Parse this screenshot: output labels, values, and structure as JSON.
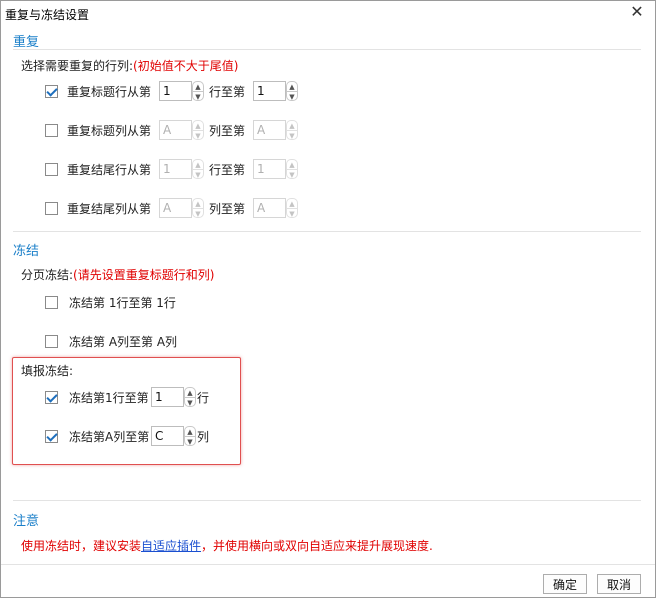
{
  "window": {
    "title": "重复与冻结设置"
  },
  "repeat": {
    "section_title": "重复",
    "prompt": "选择需要重复的行列:",
    "hint": "(初始值不大于尾值)",
    "rows": [
      {
        "label": "重复标题行从第",
        "checked": true,
        "from": "1",
        "mid": "行至第",
        "to": "1",
        "enabled": true
      },
      {
        "label": "重复标题列从第",
        "checked": false,
        "from": "A",
        "mid": "列至第",
        "to": "A",
        "enabled": false
      },
      {
        "label": "重复结尾行从第",
        "checked": false,
        "from": "1",
        "mid": "行至第",
        "to": "1",
        "enabled": false
      },
      {
        "label": "重复结尾列从第",
        "checked": false,
        "from": "A",
        "mid": "列至第",
        "to": "A",
        "enabled": false
      }
    ]
  },
  "freeze": {
    "section_title": "冻结",
    "page_prompt": "分页冻结:",
    "page_hint": "(请先设置重复标题行和列)",
    "page_rows": [
      {
        "label": "冻结第 1行至第 1行",
        "checked": false
      },
      {
        "label": "冻结第 A列至第 A列",
        "checked": false
      }
    ],
    "fill_prompt": "填报冻结:",
    "fill_rows": [
      {
        "label": "冻结第1行至第",
        "value": "1",
        "suffix": "行",
        "checked": true
      },
      {
        "label": "冻结第A列至第",
        "value": "C",
        "suffix": "列",
        "checked": true
      }
    ]
  },
  "notice": {
    "section_title": "注意",
    "text_before": "使用冻结时，建议安装",
    "link": "自适应插件",
    "text_after": "，并使用横向或双向自适应来提升展现速度."
  },
  "buttons": {
    "ok": "确定",
    "cancel": "取消"
  }
}
